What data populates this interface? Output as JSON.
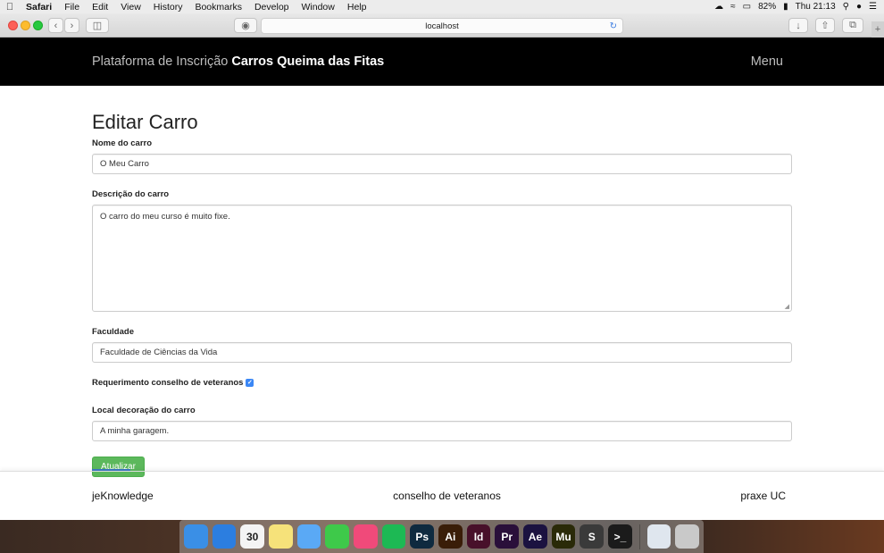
{
  "menubar": {
    "items": [
      "Safari",
      "File",
      "Edit",
      "View",
      "History",
      "Bookmarks",
      "Develop",
      "Window",
      "Help"
    ],
    "battery": "82%",
    "clock": "Thu 21:13"
  },
  "browser": {
    "url": "localhost"
  },
  "navbar": {
    "brand_prefix": "Plataforma de Inscrição ",
    "brand_bold": "Carros Queima das Fitas",
    "menu_label": "Menu"
  },
  "form": {
    "title": "Editar Carro",
    "nome_label": "Nome do carro",
    "nome_value": "O Meu Carro",
    "descricao_label": "Descrição do carro",
    "descricao_value": "O carro do meu curso é muito fixe.",
    "faculdade_label": "Faculdade",
    "faculdade_value": "Faculdade de Ciências da Vida",
    "requerimento_label": "Requerimento conselho de veteranos",
    "requerimento_checked": true,
    "local_label": "Local decoração do carro",
    "local_value": "A minha garagem.",
    "submit_label": "Atualizar"
  },
  "footer": {
    "left": "jeKnowledge",
    "center": "conselho de veteranos",
    "right": "praxe UC"
  },
  "dock": {
    "icons": [
      {
        "name": "finder",
        "label": "",
        "color": "#3a8fe6"
      },
      {
        "name": "safari",
        "label": "",
        "color": "#2c7ee0"
      },
      {
        "name": "calendar",
        "label": "30",
        "color": "#f4f4f4"
      },
      {
        "name": "notes",
        "label": "",
        "color": "#f6e27a"
      },
      {
        "name": "messages",
        "label": "",
        "color": "#5aa9f5"
      },
      {
        "name": "facetime",
        "label": "",
        "color": "#3ec94a"
      },
      {
        "name": "itunes",
        "label": "",
        "color": "#f04a7a"
      },
      {
        "name": "spotify",
        "label": "",
        "color": "#1db954"
      },
      {
        "name": "photoshop",
        "label": "Ps",
        "color": "#0f2a3f"
      },
      {
        "name": "illustrator",
        "label": "Ai",
        "color": "#3a1d08"
      },
      {
        "name": "indesign",
        "label": "Id",
        "color": "#48102a"
      },
      {
        "name": "premiere",
        "label": "Pr",
        "color": "#2a0f3a"
      },
      {
        "name": "after-effects",
        "label": "Ae",
        "color": "#1b1240"
      },
      {
        "name": "muse",
        "label": "Mu",
        "color": "#2a2a08"
      },
      {
        "name": "sublime",
        "label": "S",
        "color": "#3a3a3a"
      },
      {
        "name": "terminal",
        "label": ">_",
        "color": "#1b1b1b"
      },
      {
        "name": "preview",
        "label": "",
        "color": "#dfe6ee"
      },
      {
        "name": "trash",
        "label": "",
        "color": "#c9c9c9"
      }
    ]
  }
}
